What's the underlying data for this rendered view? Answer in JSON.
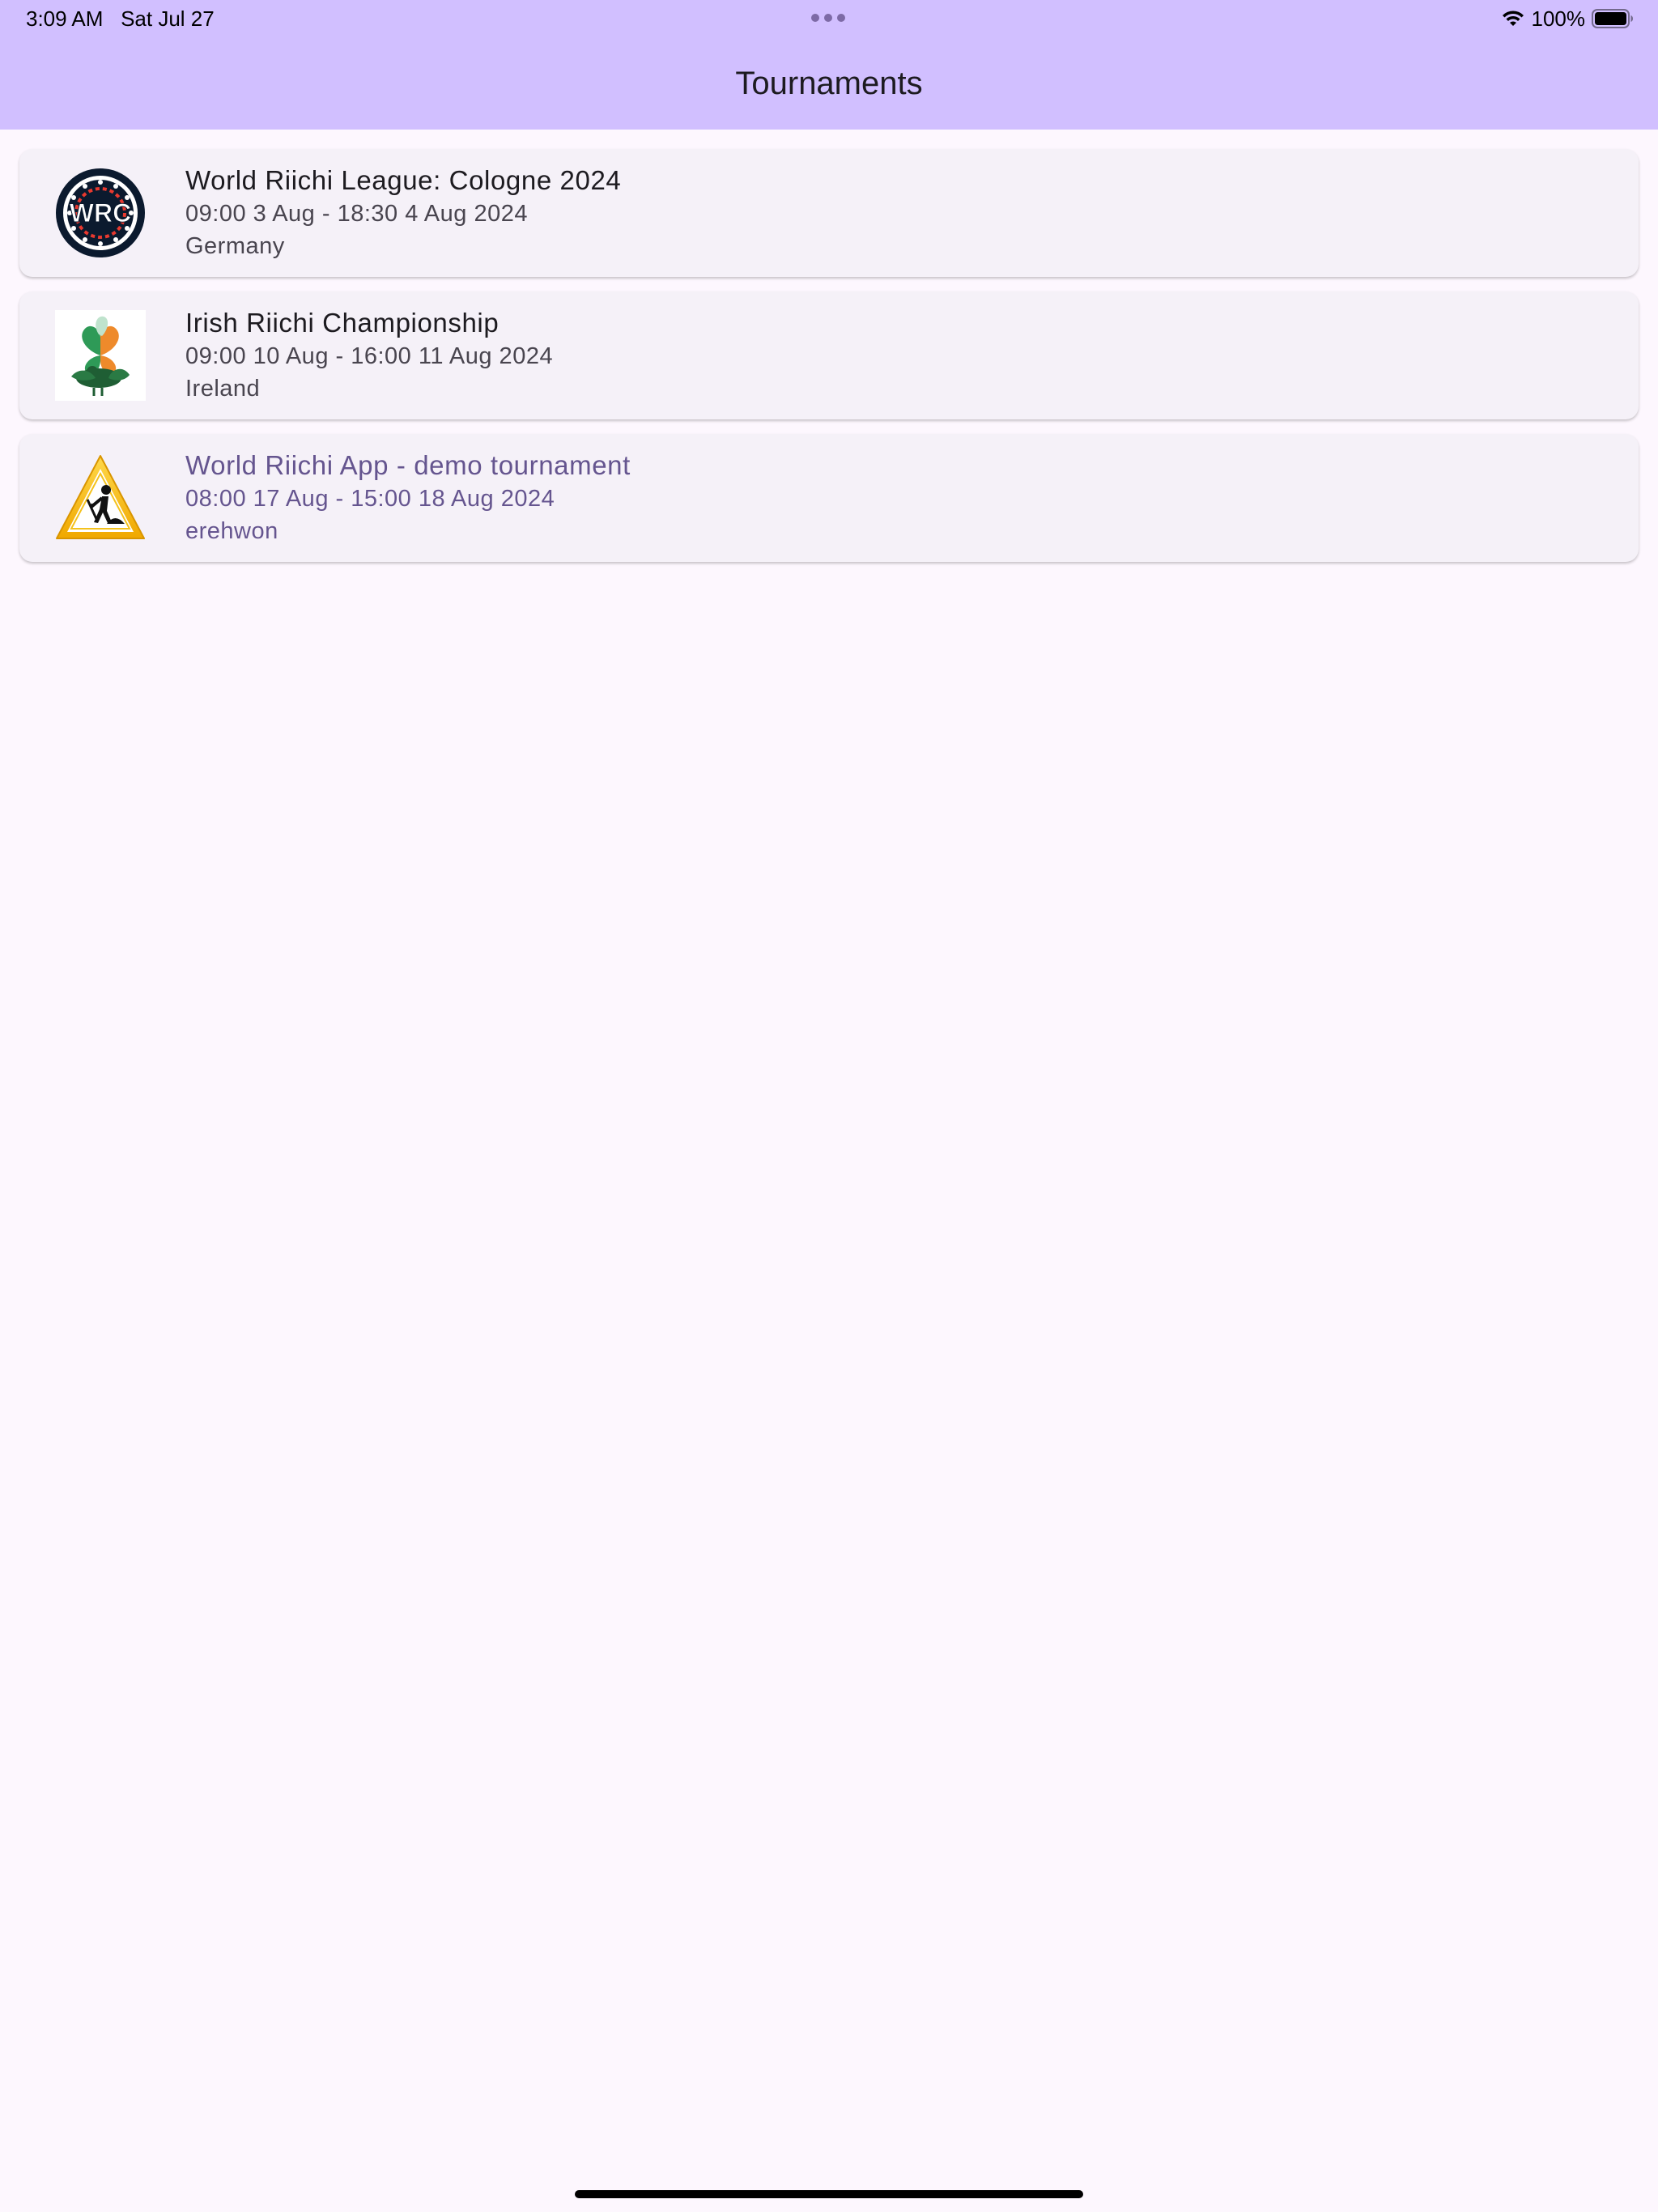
{
  "status_bar": {
    "time": "3:09 AM",
    "date": "Sat Jul 27",
    "battery": "100%"
  },
  "app_bar": {
    "title": "Tournaments"
  },
  "tournaments": [
    {
      "name": "World Riichi League: Cologne 2024",
      "dates": "09:00 3 Aug - 18:30 4 Aug 2024",
      "country": "Germany",
      "logo": "wrc-logo",
      "selected": false
    },
    {
      "name": "Irish Riichi Championship",
      "dates": "09:00 10 Aug - 16:00 11 Aug 2024",
      "country": "Ireland",
      "logo": "irish-shamrock-logo",
      "selected": false
    },
    {
      "name": "World Riichi App - demo tournament",
      "dates": "08:00 17 Aug - 15:00 18 Aug 2024",
      "country": "erehwon",
      "logo": "under-construction-icon",
      "selected": true
    }
  ],
  "colors": {
    "app_bar": "#d1bfff",
    "background": "#fdf7fe",
    "card": "#f5f1f8",
    "selected_text": "#65558f"
  }
}
